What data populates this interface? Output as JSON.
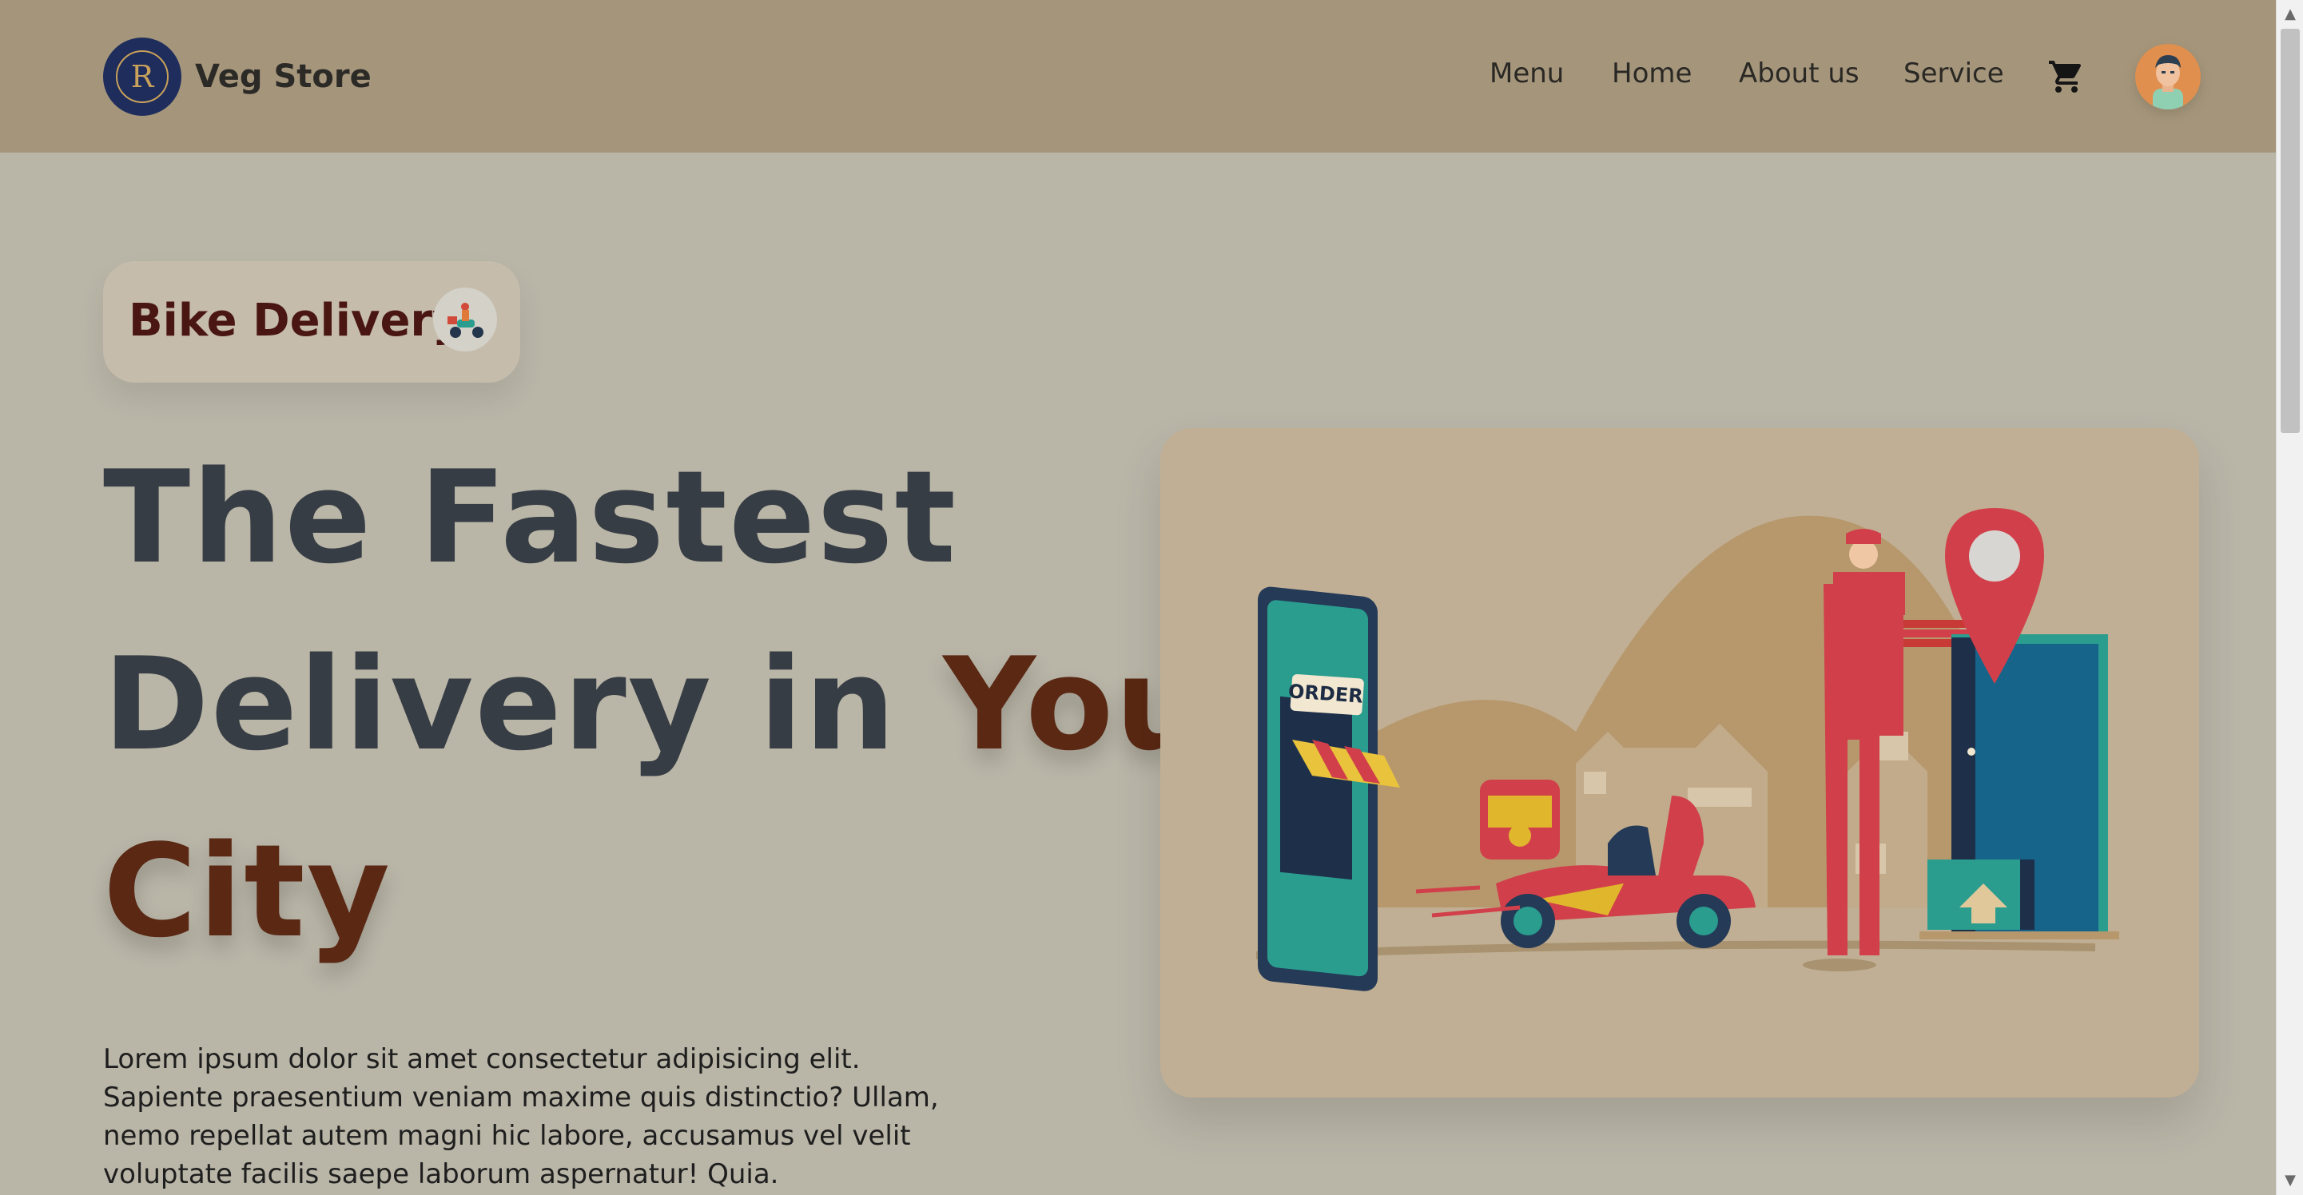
{
  "header": {
    "brand_name": "Veg Store",
    "logo_letter": "R",
    "nav": [
      "Menu",
      "Home",
      "About us",
      "Service"
    ]
  },
  "hero": {
    "badge_label": "Bike Delivery",
    "headline": {
      "line1": "The Fastest",
      "line2_plain": "Delivery in",
      "line2_accent": "Your",
      "line3_accent": "City"
    },
    "paragraph": "Lorem ipsum dolor sit amet consectetur adipisicing elit. Sapiente praesentium veniam maxime quis distinctio? Ullam, nemo repellat autem magni hic labore, accusamus vel velit voluptate facilis saepe laborum aspernatur! Quia.",
    "illustration_sign": "ORDER"
  },
  "colors": {
    "header_bg": "#a5967b",
    "page_bg": "#b9b5a7",
    "headline_dark": "#373d44",
    "headline_accent": "#5a2813",
    "badge_text": "#4a1612",
    "card_bg": "#c0af94"
  },
  "icons": [
    "brand-logo",
    "cart-icon",
    "user-avatar",
    "scooter-icon",
    "delivery-illustration"
  ]
}
